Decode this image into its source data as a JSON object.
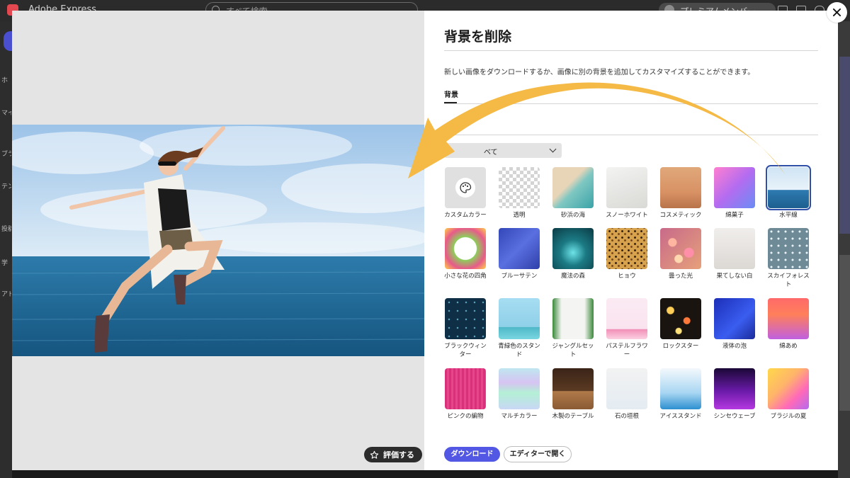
{
  "app": {
    "name": "Adobe Express",
    "search_placeholder": "すべて検索",
    "premium_label": "プレミアムメンバー",
    "rail_labels": [
      "ホ",
      "マイ",
      "ブラ",
      "テン",
      "投稿",
      "学",
      "アド"
    ]
  },
  "modal": {
    "title": "背景を削除",
    "description": "新しい画像をダウンロードするか、画像に別の背景を追加してカスタマイズすることができます。",
    "tab_label": "背景",
    "filter_value": "べて",
    "rate_label": "評価する",
    "download_label": "ダウンロード",
    "open_editor_label": "エディターで開く",
    "tiles": [
      {
        "label": "カスタムカラー",
        "icon": "palette-icon"
      },
      {
        "label": "透明"
      },
      {
        "label": "砂浜の海"
      },
      {
        "label": "スノーホワイト"
      },
      {
        "label": "コスメティック"
      },
      {
        "label": "綿菓子"
      },
      {
        "label": "水平線",
        "selected": true
      },
      {
        "label": "小さな花の四角"
      },
      {
        "label": "ブルーサテン"
      },
      {
        "label": "魔法の森"
      },
      {
        "label": "ヒョウ"
      },
      {
        "label": "曇った光"
      },
      {
        "label": "果てしない白"
      },
      {
        "label": "スカイフォレスト"
      },
      {
        "label": "ブラックウィンター"
      },
      {
        "label": "青緑色のスタンド"
      },
      {
        "label": "ジャングルセット"
      },
      {
        "label": "パステルフラワー"
      },
      {
        "label": "ロックスター"
      },
      {
        "label": "液体の泡"
      },
      {
        "label": "綿あめ"
      },
      {
        "label": "ピンクの編物"
      },
      {
        "label": "マルチカラー"
      },
      {
        "label": "木製のテーブル"
      },
      {
        "label": "石の垣根"
      },
      {
        "label": "アイススタンド"
      },
      {
        "label": "シンセウェーブ"
      },
      {
        "label": "ブラジルの夏"
      }
    ]
  },
  "colors": {
    "accent": "#5258e4",
    "arrow": "#f5b945",
    "selected_outline": "#2f4fa8"
  }
}
